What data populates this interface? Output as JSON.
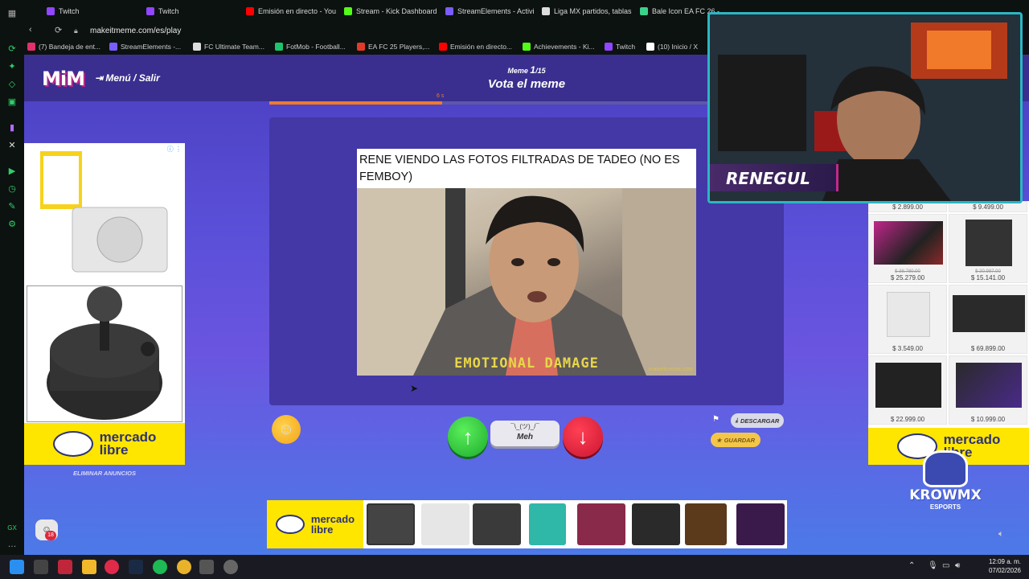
{
  "tabs": [
    {
      "label": "Twitch",
      "color": "#9146ff"
    },
    {
      "label": "Twitch",
      "color": "#9146ff"
    },
    {
      "label": "Emisión en directo - You",
      "color": "#ff0000"
    },
    {
      "label": "Stream - Kick Dashboard",
      "color": "#53fc18"
    },
    {
      "label": "StreamElements - Activi",
      "color": "#7a5cff"
    },
    {
      "label": "Liga MX partidos, tablas",
      "color": "#dddddd"
    },
    {
      "label": "Bale Icon EA FC 26 -",
      "color": "#3bd18a"
    }
  ],
  "address": {
    "url": "makeitmeme.com/es/play"
  },
  "bookmarks": [
    {
      "label": "(7) Bandeja de ent...",
      "color": "#e1306c"
    },
    {
      "label": "StreamElements -...",
      "color": "#7a5cff"
    },
    {
      "label": "FC Ultimate Team...",
      "color": "#dddddd"
    },
    {
      "label": "FotMob - Football...",
      "color": "#1ec46b"
    },
    {
      "label": "EA FC 25 Players,...",
      "color": "#e03a2a"
    },
    {
      "label": "Emisión en directo...",
      "color": "#ff0000"
    },
    {
      "label": "Achievements - Ki...",
      "color": "#53fc18"
    },
    {
      "label": "Twitch",
      "color": "#9146ff"
    },
    {
      "label": "(10) Inicio / X",
      "color": "#ffffff"
    }
  ],
  "header": {
    "logo": "MiM",
    "menu": "Menú / Salir",
    "meme_label": "Meme",
    "meme_current": "1",
    "meme_total": "/15",
    "title": "Vota el meme",
    "timer": "6 s"
  },
  "meme": {
    "text": "RENE VIENDO LAS FOTOS FILTRADAS DE TADEO  (NO ES FEMBOY)",
    "caption": "EMOTIONAL DAMAGE",
    "watermark": "makeitmeme.com"
  },
  "actions": {
    "meh_face": "¯\\_(ツ)_/¯",
    "meh_label": "Meh",
    "download": "DESCARGAR",
    "save": "GUARDAR"
  },
  "ads": {
    "remove": "ELIMINAR ANUNCIOS",
    "brand": "mercado libre",
    "brand_line1": "mercado",
    "brand_line2": "libre",
    "prices": [
      {
        "old": "",
        "new": "$ 2.899.00"
      },
      {
        "old": "",
        "new": "$ 9.499.00"
      },
      {
        "old": "$ 38.780.00",
        "new": "$ 25.279.00"
      },
      {
        "old": "$ 20.987.00",
        "new": "$ 15.141.00"
      },
      {
        "old": "",
        "new": "$ 3.549.00"
      },
      {
        "old": "",
        "new": "$ 69.899.00"
      },
      {
        "old": "",
        "new": "$ 22.999.00"
      },
      {
        "old": "",
        "new": "$ 10.999.00"
      }
    ]
  },
  "webcam": {
    "name": "RENEGUL"
  },
  "overlay": {
    "team": "KROWMX",
    "sub": "ESPORTS"
  },
  "badge": {
    "age": "18"
  },
  "clock": {
    "time": "12:09 a. m.",
    "date": "07/02/2026"
  }
}
